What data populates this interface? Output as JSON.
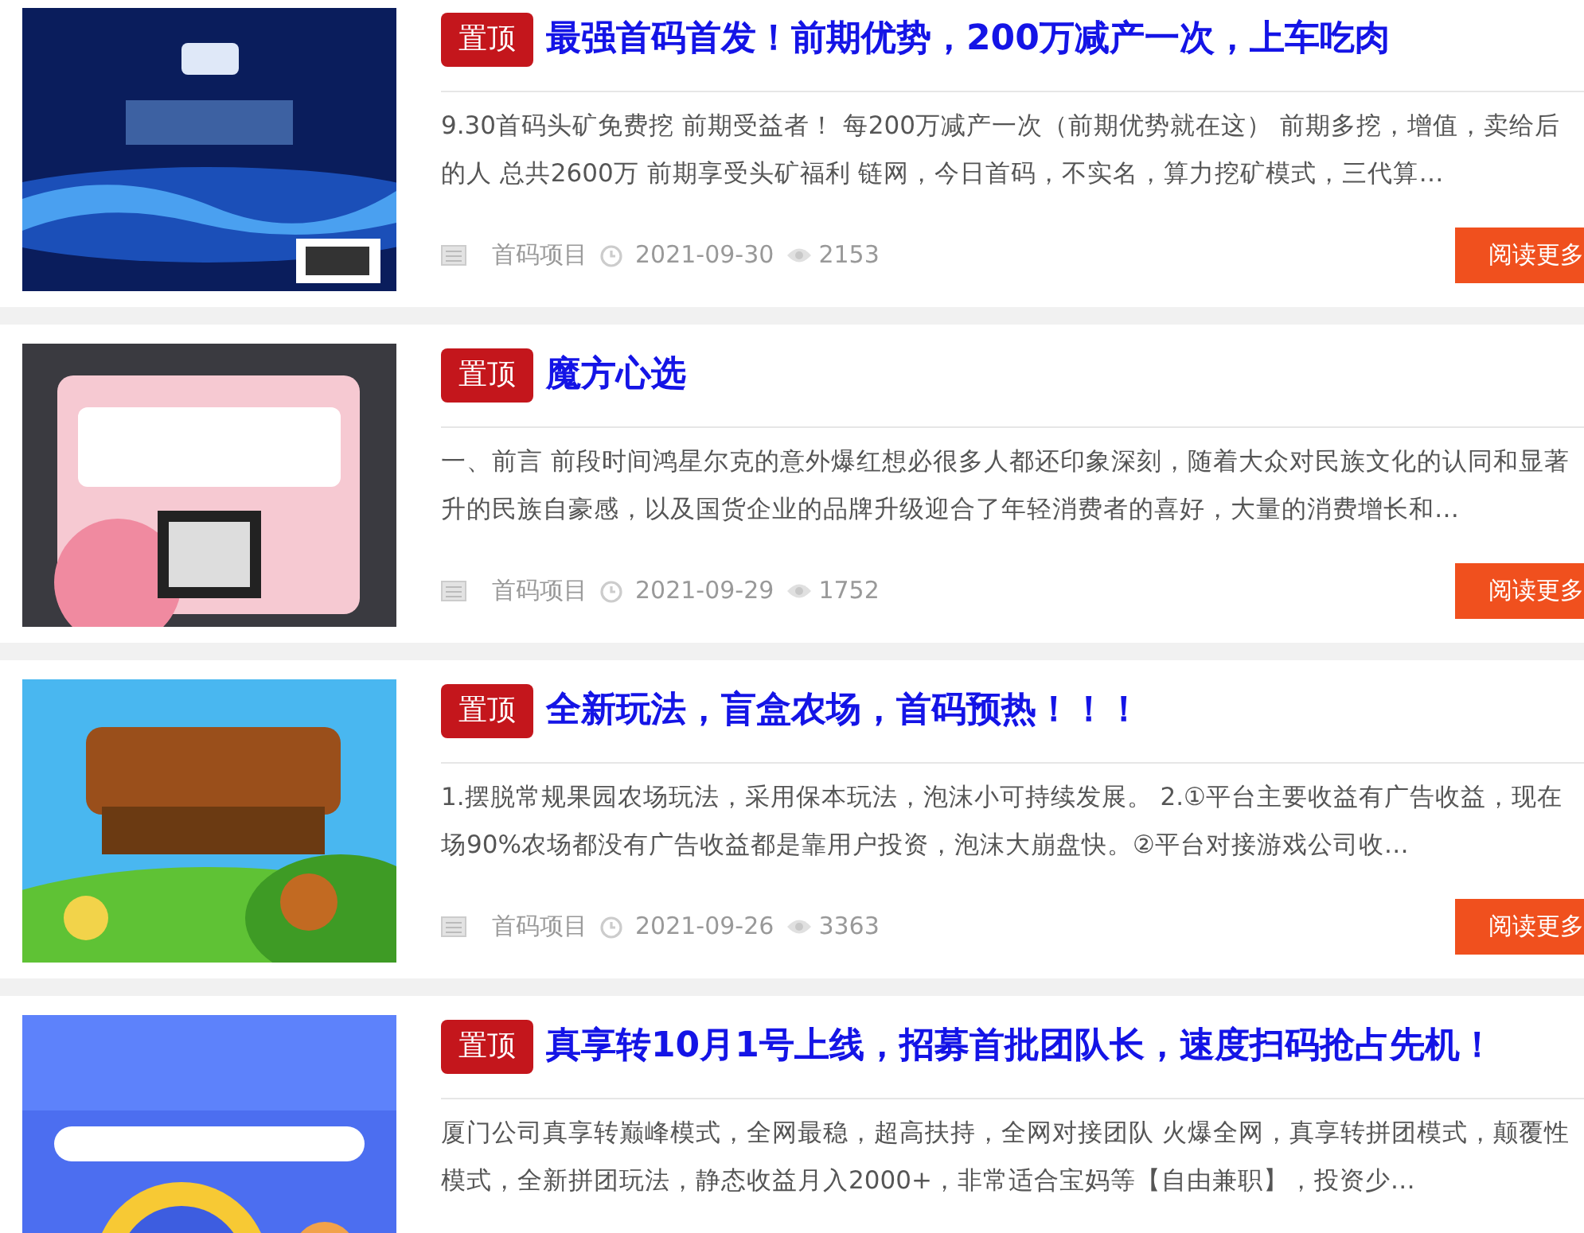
{
  "articles": [
    {
      "pinned_label": "置顶",
      "title": "最强首码首发！前期优势，200万减产一次，上车吃肉",
      "excerpt_lines": [
        "9.30首码头矿免费挖 前期受益者！ 每200万减产一次（前期优势就在这） 前期多挖，增值，卖给后",
        "的人 总共2600万 前期享受头矿福利 链网，今日首码，不实名，算力挖矿模式，三代算…"
      ],
      "category": "首码项目",
      "date": "2021-09-30",
      "views": "2153",
      "button": "阅读更多"
    },
    {
      "pinned_label": "置顶",
      "title": "魔方心选",
      "excerpt_lines": [
        "一、前言 前段时间鸿星尔克的意外爆红想必很多人都还印象深刻，随着大众对民族文化的认同和显著",
        "升的民族自豪感，以及国货企业的品牌升级迎合了年轻消费者的喜好，大量的消费增长和…"
      ],
      "category": "首码项目",
      "date": "2021-09-29",
      "views": "1752",
      "button": "阅读更多"
    },
    {
      "pinned_label": "置顶",
      "title": "全新玩法，盲盒农场，首码预热！！！",
      "excerpt_lines": [
        "1.摆脱常规果园农场玩法，采用保本玩法，泡沫小可持续发展。 2.①平台主要收益有广告收益，现在",
        "场90%农场都没有广告收益都是靠用户投资，泡沫大崩盘快。②平台对接游戏公司收…"
      ],
      "category": "首码项目",
      "date": "2021-09-26",
      "views": "3363",
      "button": "阅读更多"
    },
    {
      "pinned_label": "置顶",
      "title": "真享转10月1号上线，招募首批团队长，速度扫码抢占先机！",
      "excerpt_lines": [
        "厦门公司真享转巅峰模式，全网最稳，超高扶持，全网对接团队 火爆全网，真享转拼团模式，颠覆性",
        "模式，全新拼团玩法，静态收益月入2000+，非常适合宝妈等【自由兼职】，投资少…"
      ]
    }
  ]
}
